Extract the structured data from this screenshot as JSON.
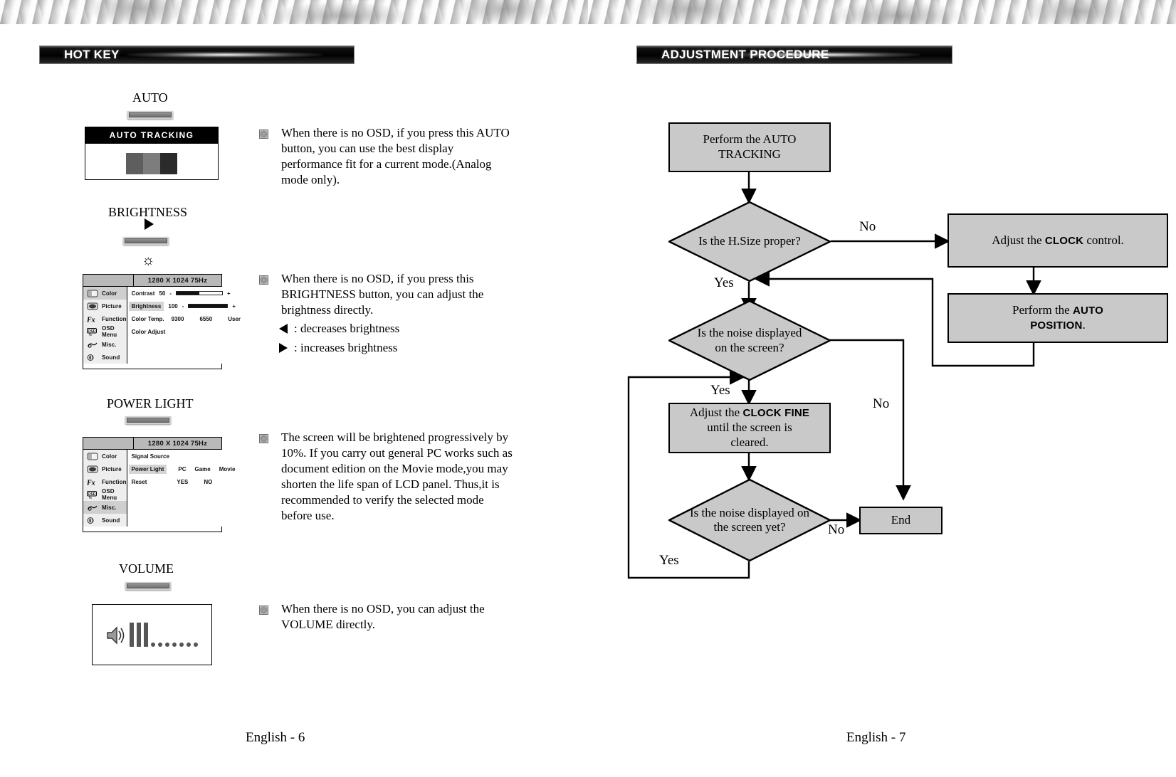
{
  "document": {
    "left_page": {
      "header": "HOT KEY",
      "footer": "English - 6",
      "sections": [
        {
          "label": "AUTO",
          "osd_title": "AUTO TRACKING",
          "bullet": "When there is no OSD, if you press this AUTO button, you can use the best display performance fit  for a current mode.(Analog mode only)."
        },
        {
          "label": "BRIGHTNESS",
          "bullet": "When there is no OSD, if you press this BRIGHTNESS button, you can adjust the brightness directly.",
          "sub_left": ":  decreases brightness",
          "sub_right": ":  increases brightness"
        },
        {
          "label": "POWER LIGHT",
          "bullet": "The screen will be brightened progressively by 10%. If you carry out general PC works such as document edition on the Movie mode,you may shorten the life span of LCD panel. Thus,it is recommended to verify the selected mode before use."
        },
        {
          "label": "VOLUME",
          "bullet": "When there is no OSD, you can adjust the VOLUME directly."
        }
      ],
      "osd_menu_color": {
        "resolution": "1280 X 1024    75Hz",
        "sidebar": [
          {
            "label": "Color",
            "icon": "color-icon",
            "selected": true
          },
          {
            "label": "Picture",
            "icon": "picture-icon",
            "selected": false
          },
          {
            "label": "Function",
            "icon": "function-icon",
            "selected": false
          },
          {
            "label": "OSD Menu",
            "icon": "osd-icon",
            "selected": false
          },
          {
            "label": "Misc.",
            "icon": "misc-icon",
            "selected": false
          },
          {
            "label": "Sound",
            "icon": "sound-icon",
            "selected": false
          }
        ],
        "rows": [
          {
            "label": "Contrast",
            "value": "50"
          },
          {
            "label": "Brightness",
            "value": "100",
            "highlighted": true
          },
          {
            "label": "Color Temp.",
            "options": [
              "9300",
              "6550",
              "User"
            ]
          },
          {
            "label": "Color Adjust"
          }
        ]
      },
      "osd_menu_misc": {
        "resolution": "1280 X 1024    75Hz",
        "sidebar": [
          {
            "label": "Color",
            "icon": "color-icon",
            "selected": false
          },
          {
            "label": "Picture",
            "icon": "picture-icon",
            "selected": false
          },
          {
            "label": "Function",
            "icon": "function-icon",
            "selected": false
          },
          {
            "label": "OSD Menu",
            "icon": "osd-icon",
            "selected": false
          },
          {
            "label": "Misc.",
            "icon": "misc-icon",
            "selected": true
          },
          {
            "label": "Sound",
            "icon": "sound-icon",
            "selected": false
          }
        ],
        "rows": [
          {
            "label": "Signal Source"
          },
          {
            "label": "Power Light",
            "highlighted": true,
            "options": [
              "PC",
              "Game",
              "Movie"
            ]
          },
          {
            "label": "Reset",
            "options": [
              "YES",
              "NO"
            ]
          }
        ]
      }
    },
    "right_page": {
      "header": "ADJUSTMENT PROCEDURE",
      "footer": "English - 7",
      "flowchart": {
        "nodes": [
          {
            "id": "start",
            "type": "process",
            "text": "Perform the AUTO TRACKING"
          },
          {
            "id": "hsize",
            "type": "decision",
            "text": "Is the H.Size proper?"
          },
          {
            "id": "clock",
            "type": "process",
            "text": "Adjust the CLOCK control."
          },
          {
            "id": "autopos",
            "type": "process",
            "text": "Perform the AUTO POSITION."
          },
          {
            "id": "noise1",
            "type": "decision",
            "text": "Is the noise displayed on the screen?"
          },
          {
            "id": "clockfine",
            "type": "process",
            "text": "Adjust the CLOCK FINE until the screen is cleared."
          },
          {
            "id": "noise2",
            "type": "decision",
            "text": "Is the noise displayed on the screen yet?"
          },
          {
            "id": "end",
            "type": "process",
            "text": "End"
          }
        ],
        "edge_labels": [
          {
            "id": "hsize-no",
            "text": "No"
          },
          {
            "id": "hsize-yes",
            "text": "Yes"
          },
          {
            "id": "noise1-yes",
            "text": "Yes"
          },
          {
            "id": "noise1-no",
            "text": "No"
          },
          {
            "id": "noise2-no",
            "text": "No"
          },
          {
            "id": "noise2-yes",
            "text": "Yes"
          }
        ]
      }
    }
  },
  "node_text": {
    "start_l1": "Perform the AUTO",
    "start_l2": "TRACKING",
    "hsize": "Is the H.Size proper?",
    "clock_a": "Adjust the ",
    "clock_b": "CLOCK",
    "clock_c": " control.",
    "autopos_a": "Perform the ",
    "autopos_b": "AUTO",
    "autopos_c": "POSITION",
    "autopos_d": ".",
    "noise1_l1": "Is the noise displayed",
    "noise1_l2": "on the screen?",
    "fine_a": "Adjust the ",
    "fine_b": "CLOCK FINE",
    "fine_c": "until the screen is",
    "fine_d": "cleared.",
    "noise2_l1": "Is the noise displayed on",
    "noise2_l2": "the screen yet?",
    "end": "End"
  },
  "osd_text": {
    "contrast_label": "Contrast",
    "contrast_value": "50",
    "brightness_label": "Brightness",
    "brightness_value": "100",
    "colortemp_label": "Color Temp.",
    "ct_9300": "9300",
    "ct_6550": "6550",
    "ct_user": "User",
    "coloradjust_label": "Color Adjust",
    "signalsource_label": "Signal Source",
    "powerlight_label": "Power Light",
    "pl_pc": "PC",
    "pl_game": "Game",
    "pl_movie": "Movie",
    "reset_label": "Reset",
    "reset_yes": "YES",
    "reset_no": "NO",
    "minus": "-",
    "plus": "+"
  }
}
